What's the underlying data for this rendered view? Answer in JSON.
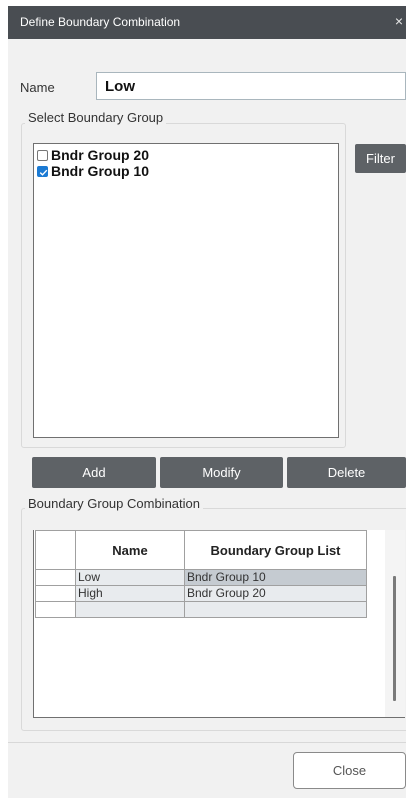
{
  "dialog": {
    "title": "Define Boundary Combination",
    "close_glyph": "×"
  },
  "name_field": {
    "label": "Name",
    "value": "Low"
  },
  "select_group": {
    "legend": "Select Boundary Group",
    "items": [
      {
        "label": "Bndr Group 20",
        "checked": false
      },
      {
        "label": "Bndr Group 10",
        "checked": true
      }
    ],
    "filter_label": "Filter"
  },
  "actions": {
    "add": "Add",
    "modify": "Modify",
    "delete": "Delete"
  },
  "combination": {
    "legend": "Boundary Group Combination",
    "columns": [
      "Name",
      "Boundary Group List"
    ],
    "rows": [
      {
        "name": "Low",
        "list": "Bndr Group 10",
        "selected": true
      },
      {
        "name": "High",
        "list": "Bndr Group 20",
        "selected": false
      },
      {
        "name": "",
        "list": "",
        "selected": false
      }
    ]
  },
  "footer": {
    "close_label": "Close"
  },
  "colors": {
    "titlebar": "#494d52",
    "button_dark": "#5e6266",
    "check_accent": "#1b7ad3"
  }
}
